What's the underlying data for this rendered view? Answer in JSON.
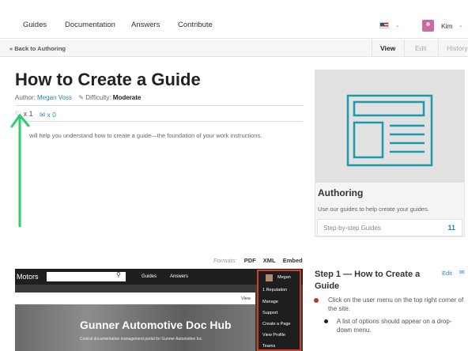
{
  "nav": {
    "links": [
      "Guides",
      "Documentation",
      "Answers",
      "Contribute"
    ],
    "user_name": "Kim"
  },
  "subnav": {
    "back_label": "Back to Authoring",
    "tabs": [
      "View",
      "Edit",
      "History"
    ]
  },
  "guide": {
    "title": "How to Create a Guide",
    "author_label": "Author:",
    "author": "Megan Voss",
    "difficulty_label": "Difficulty:",
    "difficulty": "Moderate",
    "favorites": "x 1",
    "comments": "x 0",
    "intro": "will help you understand how to create a guide—the foundation of your work instructions."
  },
  "sidebar": {
    "title": "Authoring",
    "description": "Use our guides to help create your guides.",
    "link_label": "Step-by-step Guides",
    "link_count": "11"
  },
  "formats": {
    "label": "Formats:",
    "options": [
      "PDF",
      "XML",
      "Embed"
    ]
  },
  "screenshot": {
    "logo": "Motors",
    "nav": [
      "Guides",
      "Answers"
    ],
    "white_bar_label": "View",
    "heading": "Gunner Automotive Doc Hub",
    "subheading": "Central documentation management portal for Gunner Automotive Inc.",
    "menu_user": "Megan",
    "menu_items": [
      "1  Reputation",
      "Manage",
      "Support",
      "Create a Page",
      "View Profile",
      "Teams"
    ]
  },
  "step": {
    "title": "Step 1 — How to Create a Guide",
    "edit_label": "Edit",
    "bullet1": "Click on the user menu on the top right corner of the site.",
    "bullet2": "A list of options should appear on a drop-down menu."
  },
  "colors": {
    "link": "#2a85c4",
    "annotation_arrow": "#2ecc71",
    "screenshot_highlight": "#d43d2a",
    "illustration": "#1a9aaa"
  }
}
